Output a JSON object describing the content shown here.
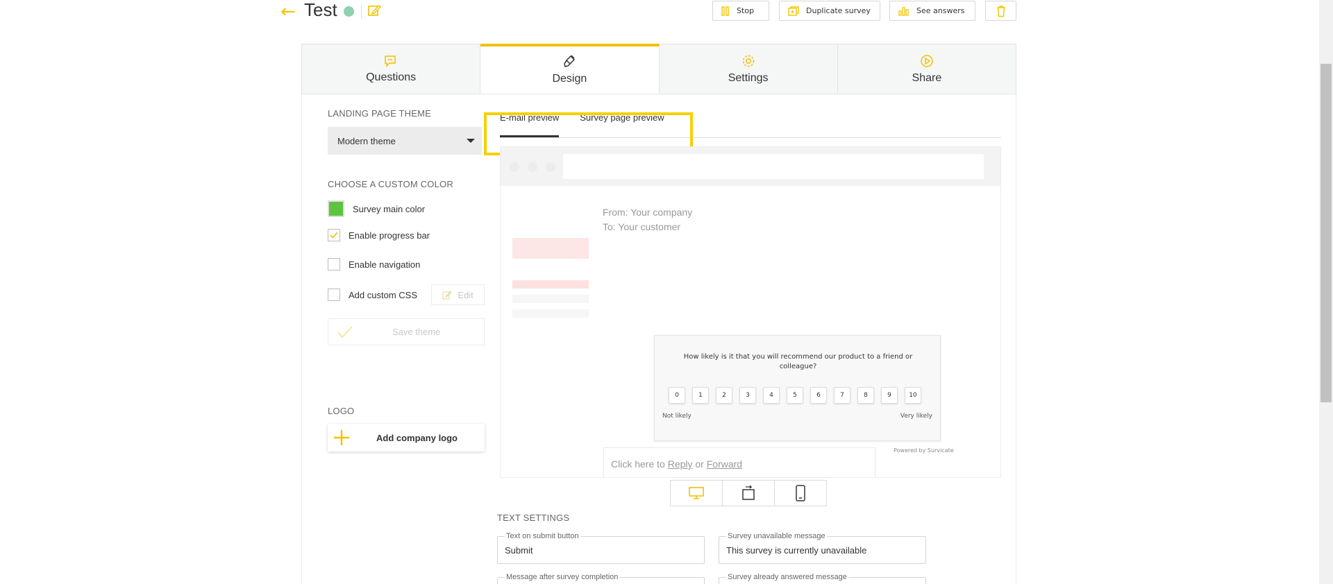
{
  "header": {
    "title": "Test",
    "buttons": {
      "stop": "Stop",
      "duplicate": "Duplicate survey",
      "answers": "See answers"
    }
  },
  "tabs": [
    {
      "label": "Questions",
      "icon": "chat-icon"
    },
    {
      "label": "Design",
      "icon": "brush-icon"
    },
    {
      "label": "Settings",
      "icon": "gear-icon"
    },
    {
      "label": "Share",
      "icon": "play-icon"
    }
  ],
  "colors": {
    "accent": "#f2c200",
    "status": "#8fd0ae",
    "main_color": "#5ec43f",
    "highlight": "#f5d000"
  },
  "sidebar": {
    "landing_theme_title": "LANDING PAGE THEME",
    "theme_value": "Modern theme",
    "custom_color_title": "CHOOSE A CUSTOM COLOR",
    "main_color_label": "Survey main color",
    "progress_bar_label": "Enable progress bar",
    "progress_bar_checked": true,
    "navigation_label": "Enable navigation",
    "navigation_checked": false,
    "custom_css_label": "Add custom CSS",
    "custom_css_checked": false,
    "edit_label": "Edit",
    "save_theme_label": "Save theme",
    "logo_title": "LOGO",
    "add_logo_label": "Add company logo"
  },
  "preview": {
    "tabs": [
      "E-mail preview",
      "Survey page preview"
    ],
    "from": "From: Your company",
    "to": "To: Your customer",
    "question": "How likely is it that you will recommend our product to a friend or colleague?",
    "scale": [
      "0",
      "1",
      "2",
      "3",
      "4",
      "5",
      "6",
      "7",
      "8",
      "9",
      "10"
    ],
    "low_label": "Not likely",
    "high_label": "Very likely",
    "powered_by": "Powered by Survicate",
    "reply_prefix": "Click here to",
    "reply_link": "Reply",
    "reply_or": "or",
    "forward_link": "Forward"
  },
  "text_settings": {
    "title": "TEXT SETTINGS",
    "submit_legend": "Text on submit button",
    "submit_value": "Submit",
    "unavailable_legend": "Survey unavailable message",
    "unavailable_value": "This survey is currently unavailable",
    "completion_legend": "Message after survey completion",
    "answered_legend": "Survey already answered message"
  }
}
